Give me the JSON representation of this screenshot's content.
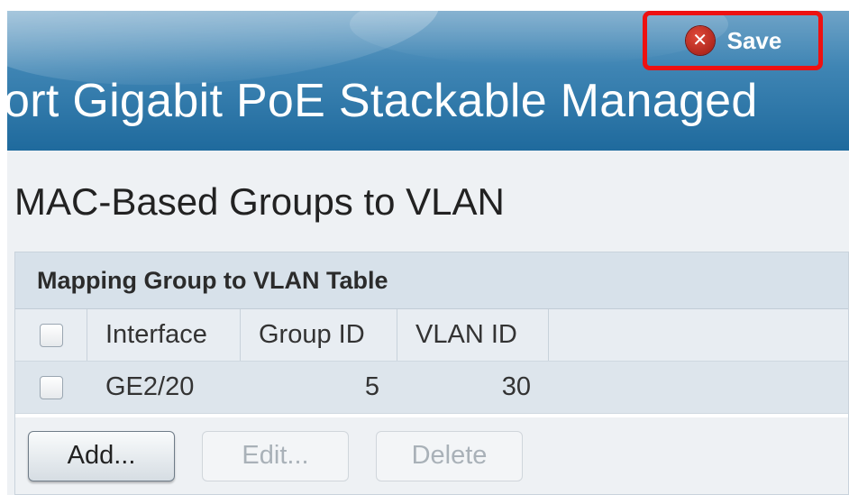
{
  "header": {
    "product_title": "ort Gigabit PoE Stackable Managed",
    "save_label": "Save",
    "save_icon": "close-circle-icon"
  },
  "page": {
    "title": "MAC-Based Groups to VLAN"
  },
  "table": {
    "caption": "Mapping Group to VLAN Table",
    "columns": [
      "Interface",
      "Group ID",
      "VLAN ID"
    ],
    "rows": [
      {
        "interface": "GE2/20",
        "group_id": "5",
        "vlan_id": "30"
      }
    ]
  },
  "buttons": {
    "add": "Add...",
    "edit": "Edit...",
    "delete": "Delete"
  },
  "colors": {
    "banner": "#3f85b4",
    "highlight": "#ee1111",
    "save_icon": "#c0281c"
  }
}
